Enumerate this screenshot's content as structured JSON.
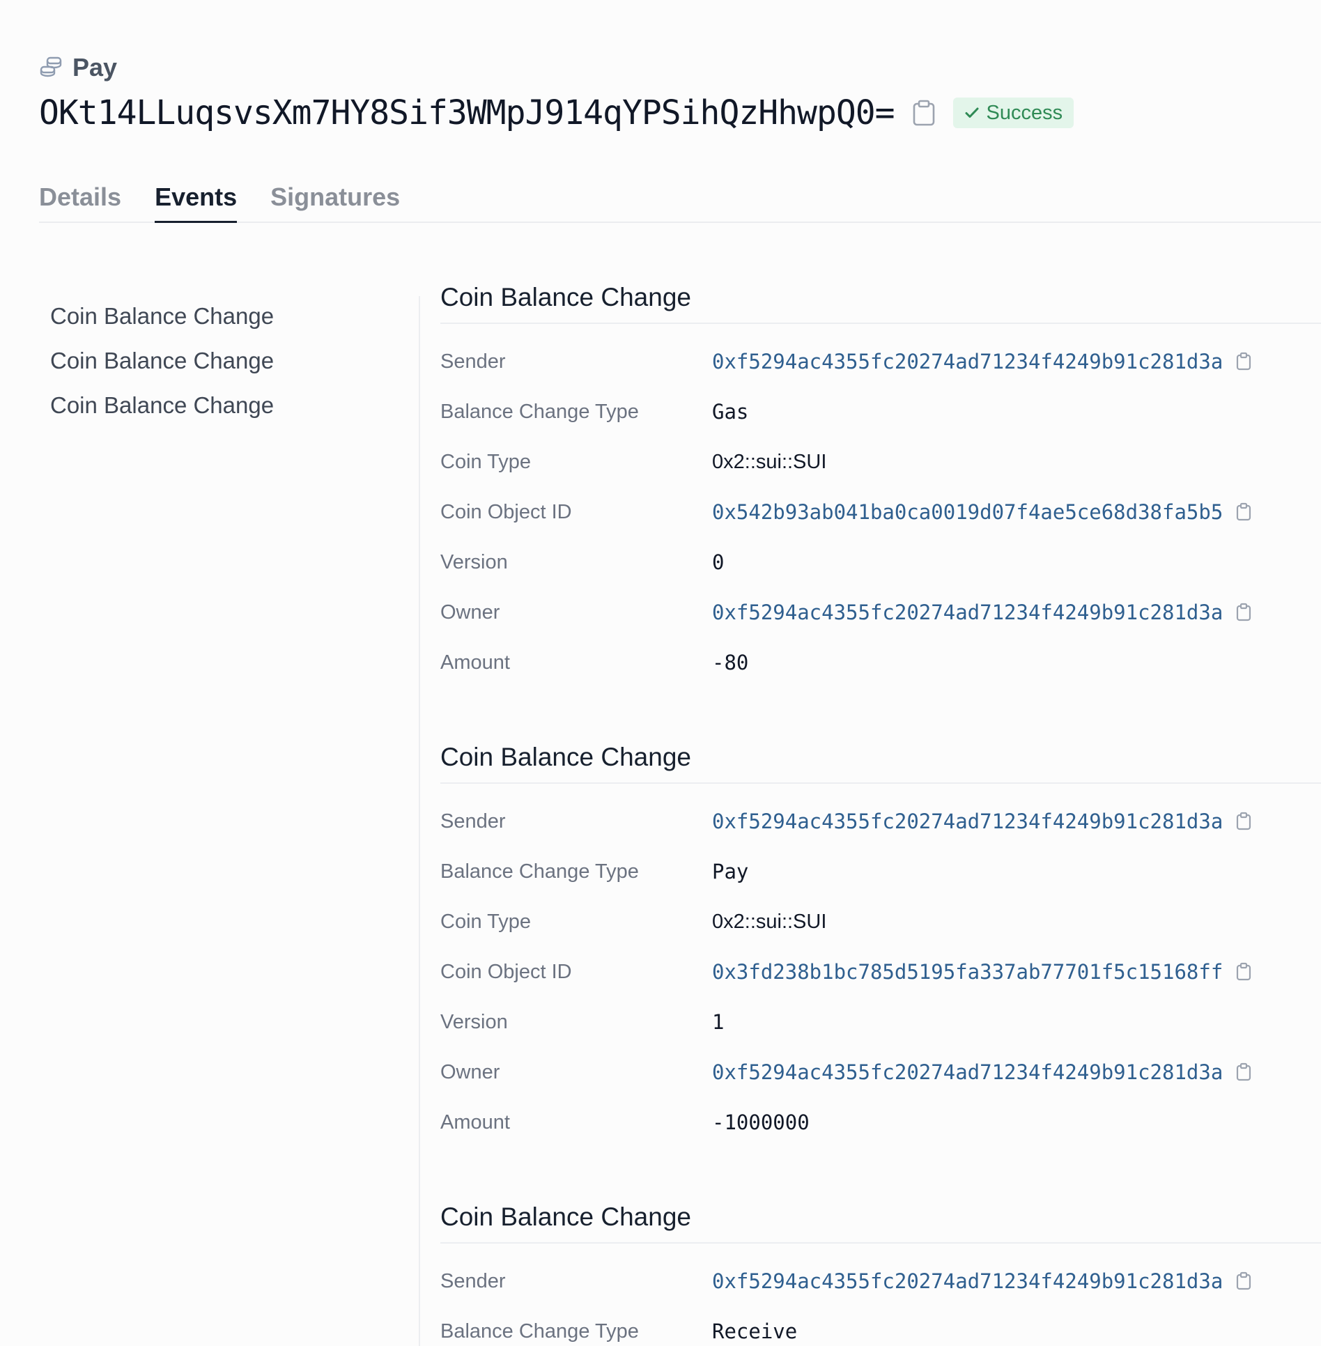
{
  "header": {
    "kind_label": "Pay",
    "tx_id": "OKt14LLuqsvsXm7HY8Sif3WMpJ914qYPSihQzHhwpQ0=",
    "status": "Success"
  },
  "tabs": [
    {
      "label": "Details",
      "active": false
    },
    {
      "label": "Events",
      "active": true
    },
    {
      "label": "Signatures",
      "active": false
    }
  ],
  "sidebar": {
    "items": [
      {
        "label": "Coin Balance Change"
      },
      {
        "label": "Coin Balance Change"
      },
      {
        "label": "Coin Balance Change"
      }
    ]
  },
  "events": [
    {
      "title": "Coin Balance Change",
      "rows": [
        {
          "label": "Sender",
          "value": "0xf5294ac4355fc20274ad71234f4249b91c281d3a"
        },
        {
          "label": "Balance Change Type",
          "value": "Gas"
        },
        {
          "label": "Coin Type",
          "value": "0x2::sui::SUI"
        },
        {
          "label": "Coin Object ID",
          "value": "0x542b93ab041ba0ca0019d07f4ae5ce68d38fa5b5"
        },
        {
          "label": "Version",
          "value": "0"
        },
        {
          "label": "Owner",
          "value": "0xf5294ac4355fc20274ad71234f4249b91c281d3a"
        },
        {
          "label": "Amount",
          "value": "-80"
        }
      ]
    },
    {
      "title": "Coin Balance Change",
      "rows": [
        {
          "label": "Sender",
          "value": "0xf5294ac4355fc20274ad71234f4249b91c281d3a"
        },
        {
          "label": "Balance Change Type",
          "value": "Pay"
        },
        {
          "label": "Coin Type",
          "value": "0x2::sui::SUI"
        },
        {
          "label": "Coin Object ID",
          "value": "0x3fd238b1bc785d5195fa337ab77701f5c15168ff"
        },
        {
          "label": "Version",
          "value": "1"
        },
        {
          "label": "Owner",
          "value": "0xf5294ac4355fc20274ad71234f4249b91c281d3a"
        },
        {
          "label": "Amount",
          "value": "-1000000"
        }
      ]
    },
    {
      "title": "Coin Balance Change",
      "rows": [
        {
          "label": "Sender",
          "value": "0xf5294ac4355fc20274ad71234f4249b91c281d3a"
        },
        {
          "label": "Balance Change Type",
          "value": "Receive"
        }
      ]
    }
  ],
  "colors": {
    "link": "#2f5f8f",
    "success_bg": "#e3f5ea",
    "success_text": "#2f8a55"
  },
  "icons": {
    "kind": "coins-icon",
    "copy": "clipboard-icon",
    "status": "check-icon"
  }
}
